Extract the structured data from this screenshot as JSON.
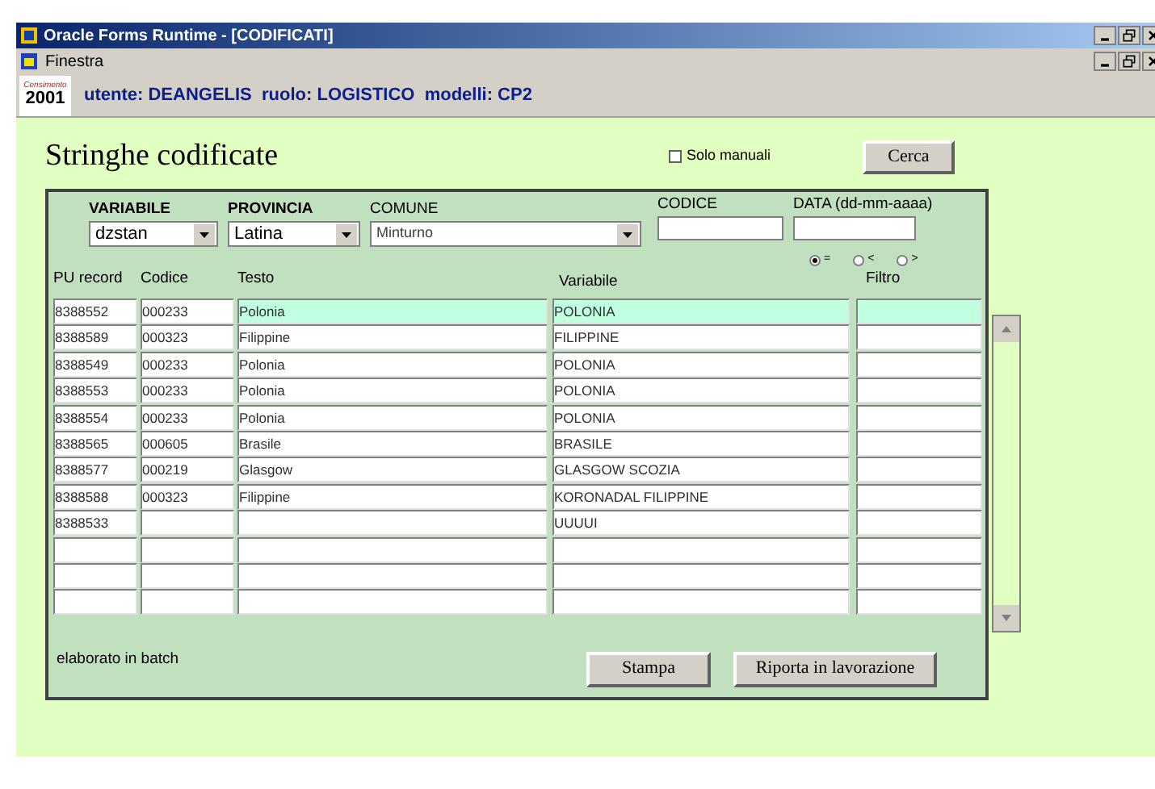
{
  "window": {
    "title": "Oracle Forms Runtime - [CODIFICATI]"
  },
  "menu": [
    "Finestra"
  ],
  "header": {
    "logo_top": "Censimento",
    "logo_text": "2001",
    "user_info": "utente: DEANGELIS  ruolo: LOGISTICO  modelli: CP2"
  },
  "form": {
    "title": "Stringhe codificate",
    "solo_manuali": {
      "label": "Solo manuali",
      "checked": false
    },
    "search_button": "Cerca"
  },
  "filters": [
    {
      "label": "VARIABILE",
      "kind": "dropdown",
      "value": "dzstan"
    },
    {
      "label": "PROVINCIA",
      "kind": "dropdown",
      "value": "Latina"
    },
    {
      "label": "COMUNE",
      "kind": "dropdown",
      "value": "Minturno"
    },
    {
      "label": "CODICE",
      "kind": "text"
    },
    {
      "label": "DATA (dd-mm-aaaa)",
      "kind": "text"
    }
  ],
  "date_compare": [
    {
      "label": "=",
      "selected": true
    },
    {
      "label": "<",
      "selected": false
    },
    {
      "label": ">",
      "selected": false
    }
  ],
  "table": {
    "columns": [
      "PU record",
      "Codice",
      "Testo",
      "Variabile",
      "Filtro"
    ],
    "rows": [
      {
        "pu": "8388552",
        "codice": "000233",
        "testo": "Polonia",
        "variabile": "POLONIA",
        "selected": true
      },
      {
        "pu": "8388589",
        "codice": "000323",
        "testo": "Filippine",
        "variabile": "FILIPPINE",
        "selected": false
      },
      {
        "pu": "8388549",
        "codice": "000233",
        "testo": "Polonia",
        "variabile": "POLONIA",
        "selected": false
      },
      {
        "pu": "8388553",
        "codice": "000233",
        "testo": "Polonia",
        "variabile": "POLONIA",
        "selected": false
      },
      {
        "pu": "8388554",
        "codice": "000233",
        "testo": "Polonia",
        "variabile": "POLONIA",
        "selected": false
      },
      {
        "pu": "8388565",
        "codice": "000605",
        "testo": "Brasile",
        "variabile": "BRASILE",
        "selected": false
      },
      {
        "pu": "8388577",
        "codice": "000219",
        "testo": "Glasgow",
        "variabile": "GLASGOW SCOZIA",
        "selected": false
      },
      {
        "pu": "8388588",
        "codice": "000323",
        "testo": "Filippine",
        "variabile": "KORONADAL FILIPPINE",
        "selected": false
      },
      {
        "pu": "8388533",
        "variabile": "UUUUI",
        "selected": false
      },
      {
        "selected": false
      },
      {
        "selected": false
      },
      {
        "selected": false
      }
    ]
  },
  "status": "elaborato in batch",
  "buttons": [
    "Stampa",
    "Riporta in lavorazione"
  ]
}
